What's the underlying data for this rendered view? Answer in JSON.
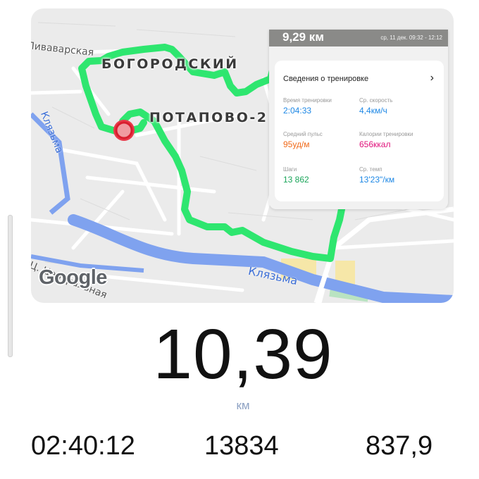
{
  "map": {
    "districts": [
      "БОГОРОДСКИЙ",
      "ПОТАПОВО-2"
    ],
    "streets": [
      "Пиваварская",
      "Ц. Центральная"
    ],
    "river": "Клязьма",
    "logo": "Google",
    "colors": {
      "route": "#2ee66f",
      "route_outline": "#3fd67a",
      "water": "#7fa2ef",
      "marker": "#e8394a",
      "land": "#ebebeb"
    }
  },
  "workout_card": {
    "distance": "9,29 км",
    "date_time": "ср, 11 дек. 09:32 - 12:12",
    "title": "Сведения о тренировке",
    "metrics": [
      {
        "label": "Время тренировки",
        "value": "2:04:33",
        "unit": "",
        "color": "#1e88e5"
      },
      {
        "label": "Ср. скорость",
        "value": "4,4",
        "unit": "км/ч",
        "color": "#1e88e5"
      },
      {
        "label": "Средний пульс",
        "value": "95",
        "unit": "уд/м",
        "color": "#f06a1a"
      },
      {
        "label": "Калории тренировки",
        "value": "656",
        "unit": "ккал",
        "color": "#e0107a"
      },
      {
        "label": "Шаги",
        "value": "13 862",
        "unit": "",
        "color": "#1aa55a"
      },
      {
        "label": "Ср. темп",
        "value": "13'23\"",
        "unit": "/км",
        "color": "#1e88e5"
      }
    ]
  },
  "summary": {
    "distance": "10,39",
    "unit": "км",
    "duration": "02:40:12",
    "steps": "13834",
    "third": "837,9"
  }
}
